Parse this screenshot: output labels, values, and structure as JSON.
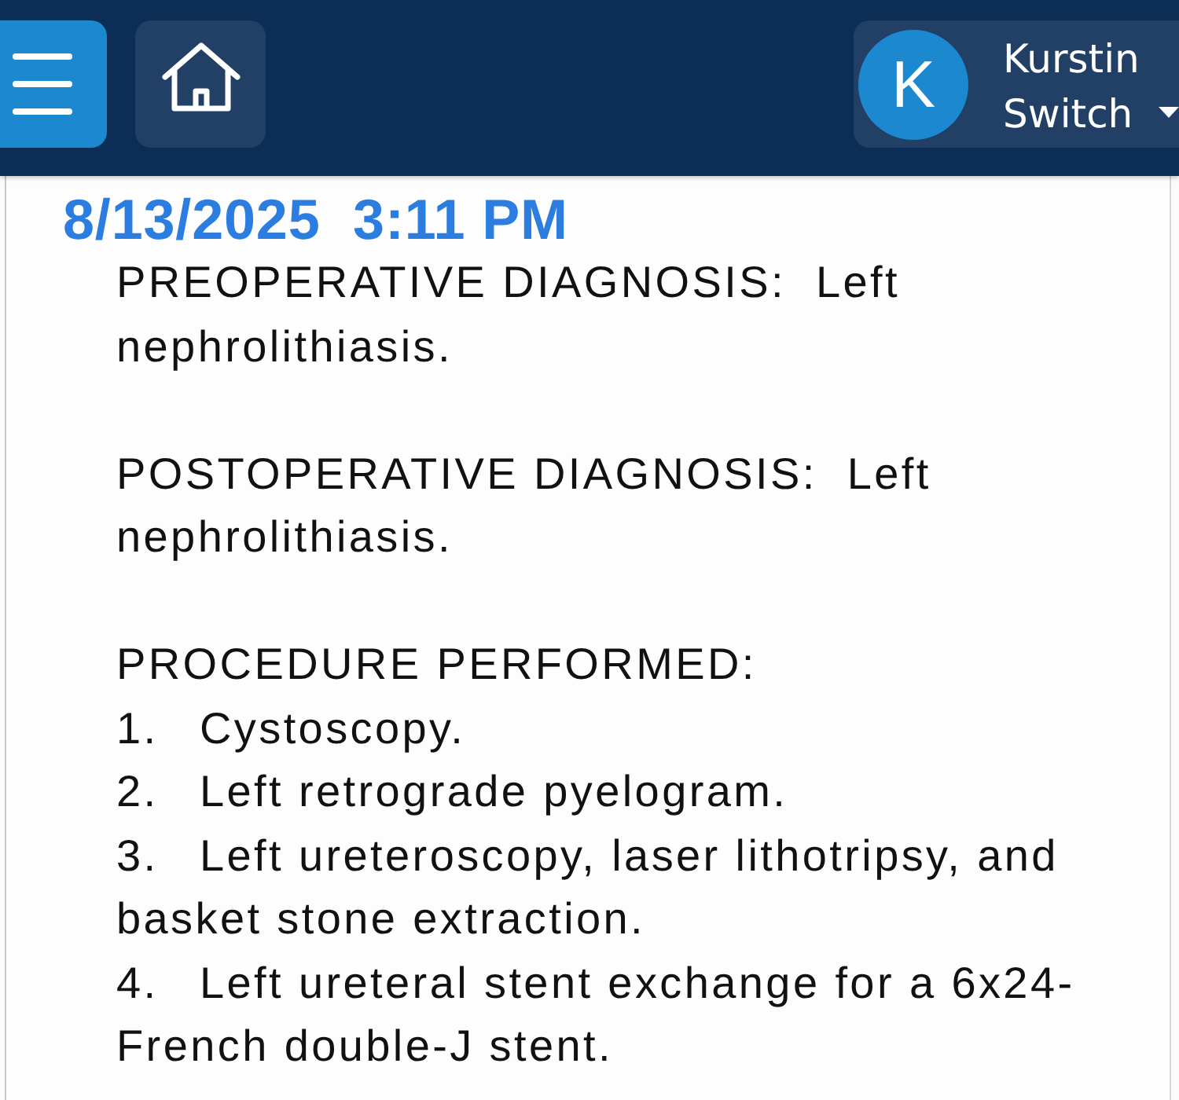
{
  "header": {
    "user": {
      "initial": "K",
      "name": "Kurstin Switch"
    }
  },
  "note": {
    "timestamp": "8/13/2025  3:11 PM",
    "sections": [
      {
        "kind": "paragraph",
        "text": "PREOPERATIVE DIAGNOSIS:  Left nephrolithiasis."
      },
      {
        "kind": "paragraph",
        "text": "POSTOPERATIVE DIAGNOSIS:  Left nephrolithiasis."
      },
      {
        "kind": "list",
        "heading": "PROCEDURE PERFORMED:",
        "items": [
          {
            "number": "1.",
            "text": "Cystoscopy."
          },
          {
            "number": "2.",
            "text": "Left retrograde pyelogram."
          },
          {
            "number": "3.",
            "text": "Left ureteroscopy, laser lithotripsy, and basket stone extraction."
          },
          {
            "number": "4.",
            "text": "Left ureteral stent exchange for a 6x24-French double-J stent."
          }
        ]
      }
    ]
  }
}
